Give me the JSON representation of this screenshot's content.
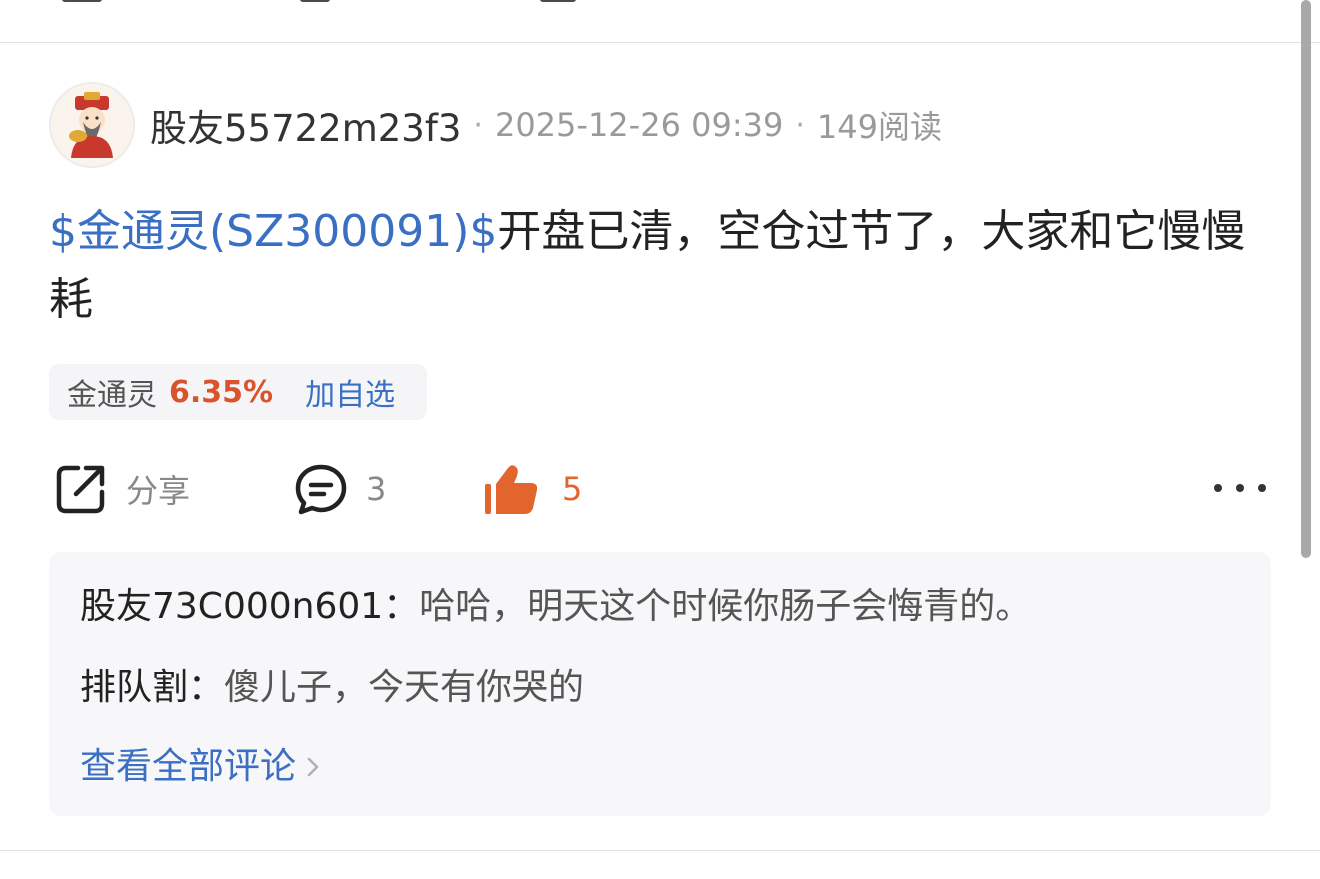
{
  "header": {
    "username": "股友55722m23f3",
    "separator": "·",
    "timestamp": "2025-12-26 09:39",
    "reads": "149阅读"
  },
  "post": {
    "stock_tag": "$金通灵(SZ300091)$",
    "text": "开盘已清，空仓过节了，大家和它慢慢耗"
  },
  "stock_chip": {
    "name": "金通灵",
    "change": "6.35%",
    "add_label": "加自选"
  },
  "actions": {
    "share_label": "分享",
    "comment_count": "3",
    "like_count": "5",
    "like_color": "#e2652e",
    "more_icon": "more-dots-icon"
  },
  "comments": {
    "items": [
      {
        "user": "股友73C000n601",
        "colon": "：",
        "text": "哈哈，明天这个时候你肠子会悔青的。"
      },
      {
        "user": "排队割",
        "colon": "：",
        "text": "傻儿子，今天有你哭的"
      }
    ],
    "view_all_label": "查看全部评论"
  },
  "colors": {
    "link_blue": "#3a6fc4",
    "up_red": "#d9532c",
    "comment_bg": "#f7f7f9"
  }
}
